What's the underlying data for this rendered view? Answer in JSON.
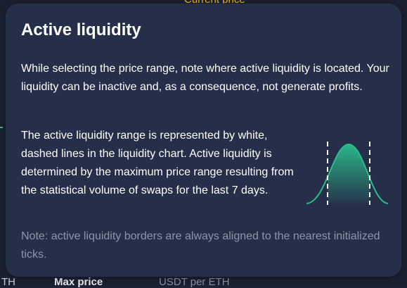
{
  "background": {
    "top_peek_text": "Current price",
    "bottom_left_text": "TH",
    "bottom_mid_text": "Max price",
    "bottom_right_text": "USDT per ETH"
  },
  "tooltip": {
    "title": "Active liquidity",
    "paragraph_1": "While selecting the price range, note where active liquidity is located. Your liquidity can be inactive and, as a consequence, not generate profits.",
    "paragraph_2": "The active liquidity range is represented by white, dashed lines in the liquidity chart. Active liquidity is determined by the maximum price range resulting from the statistical volume of swaps for the last 7 days.",
    "note": "Note: active liquidity borders are always aligned to the nearest initialized ticks.",
    "illustration": {
      "icon": "liquidity-bell-curve-icon",
      "curve_color": "#2bbd8d",
      "border_line_color": "#ffffff"
    }
  },
  "colors": {
    "tooltip_bg": "#262f49",
    "page_bg": "#1b2030",
    "note_text": "#8e95a9",
    "accent_green": "#2bbd8d",
    "current_price_yellow": "#f0b90b"
  }
}
